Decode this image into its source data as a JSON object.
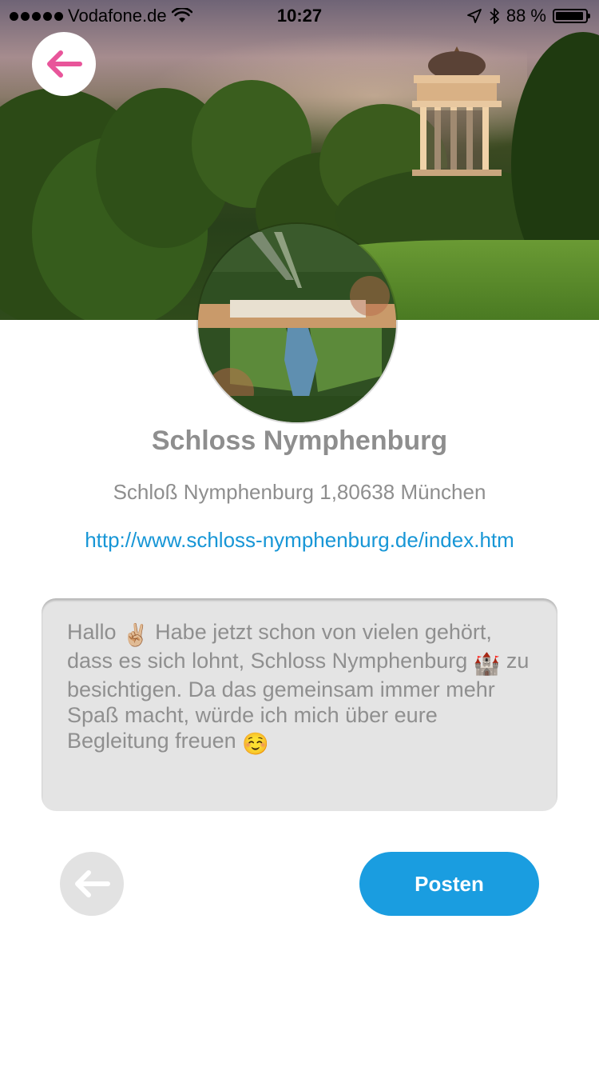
{
  "status_bar": {
    "carrier": "Vodafone.de",
    "time": "10:27",
    "battery_percent": "88 %"
  },
  "place": {
    "name": "Schloss Nymphenburg",
    "address": "Schloß Nymphenburg 1,80638 München",
    "url": "http://www.schloss-nymphenburg.de/index.htm"
  },
  "post": {
    "text_1": "Hallo ",
    "emoji_peace": "✌🏼",
    "text_2": " Habe jetzt schon von vielen gehört, dass es sich lohnt, Schloss Nymphenburg ",
    "emoji_castle": "🏰",
    "text_3": " zu besichtigen. Da das gemeinsam immer mehr Spaß macht, würde ich mich über eure Begleitung freuen ",
    "emoji_smile": "☺️"
  },
  "actions": {
    "post_label": "Posten"
  },
  "colors": {
    "accent": "#1a9de0",
    "back_arrow_top": "#e8559a",
    "back_arrow_bottom": "#ffffff",
    "text_gray": "#8e8e8e",
    "link": "#1796d6"
  },
  "icons": {
    "back_top": "arrow-left-icon",
    "back_bottom": "arrow-left-icon",
    "wifi": "wifi-icon",
    "location": "location-arrow-icon",
    "bluetooth": "bluetooth-icon",
    "battery": "battery-icon"
  }
}
